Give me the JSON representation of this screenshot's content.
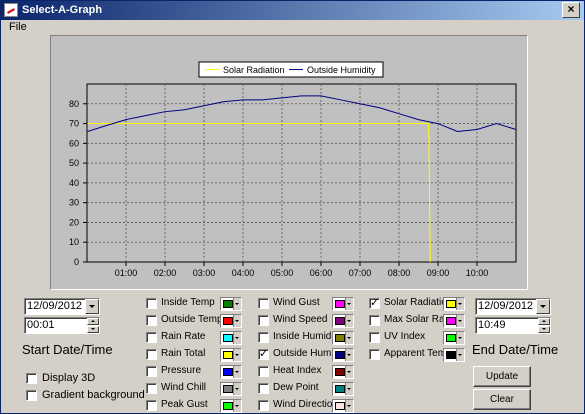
{
  "window": {
    "title": "Select-A-Graph",
    "close_glyph": "×"
  },
  "menu": {
    "file": "File"
  },
  "chart_data": {
    "type": "line",
    "legend": [
      "Solar Radiation",
      "Outside Humidity"
    ],
    "legend_position": "top-center",
    "grid": true,
    "ylim": [
      0,
      90
    ],
    "yticks": [
      "0",
      "10",
      "20",
      "30",
      "40",
      "50",
      "60",
      "70",
      "80"
    ],
    "xlim": [
      "00:00",
      "11:00"
    ],
    "xticks": [
      "01:00",
      "02:00",
      "03:00",
      "04:00",
      "05:00",
      "06:00",
      "07:00",
      "08:00",
      "09:00",
      "10:00"
    ],
    "series": [
      {
        "name": "Solar Radiation",
        "color": "#ffff00",
        "x": [
          "00:01",
          "08:45",
          "08:46",
          "08:48"
        ],
        "y": [
          70,
          70,
          65,
          0
        ]
      },
      {
        "name": "Outside Humidity",
        "color": "#000080",
        "x": [
          "00:01",
          "00:30",
          "01:00",
          "01:30",
          "02:00",
          "02:30",
          "03:00",
          "03:30",
          "04:00",
          "04:30",
          "05:00",
          "05:30",
          "06:00",
          "06:30",
          "07:00",
          "07:30",
          "08:00",
          "08:30",
          "08:45",
          "09:00",
          "09:30",
          "10:00",
          "10:30",
          "11:00"
        ],
        "y": [
          66,
          69,
          72,
          74,
          76,
          77,
          79,
          81,
          82,
          82,
          83,
          84,
          84,
          82,
          80,
          78,
          75,
          72,
          71,
          70,
          66,
          67,
          70,
          67
        ]
      }
    ]
  },
  "start": {
    "date": "12/09/2012",
    "time": "00:01",
    "label": "Start Date/Time"
  },
  "end": {
    "date": "12/09/2012",
    "time": "10:49",
    "label": "End Date/Time"
  },
  "options": {
    "display3d": "Display 3D",
    "gradient": "Gradient background"
  },
  "series_col1": [
    {
      "label": "Inside Temp",
      "checked": false,
      "color": "#008000"
    },
    {
      "label": "Outside Temp",
      "checked": false,
      "color": "#ff0000"
    },
    {
      "label": "Rain Rate",
      "checked": false,
      "color": "#00ffff"
    },
    {
      "label": "Rain Total",
      "checked": false,
      "color": "#ffff00"
    },
    {
      "label": "Pressure",
      "checked": false,
      "color": "#0000ff"
    },
    {
      "label": "Wind Chill",
      "checked": false,
      "color": "#808080"
    },
    {
      "label": "Peak Gust",
      "checked": false,
      "color": "#00ff00"
    }
  ],
  "series_col2": [
    {
      "label": "Wind Gust",
      "checked": false,
      "color": "#ff00ff"
    },
    {
      "label": "Wind Speed",
      "checked": false,
      "color": "#800080"
    },
    {
      "label": "Inside Humidity",
      "checked": false,
      "color": "#808000"
    },
    {
      "label": "Outside Humidit",
      "checked": true,
      "color": "#000080"
    },
    {
      "label": "Heat Index",
      "checked": false,
      "color": "#800000"
    },
    {
      "label": "Dew Point",
      "checked": false,
      "color": "#008080"
    },
    {
      "label": "Wind Direction",
      "checked": false,
      "color": "#ffe0e0"
    }
  ],
  "series_col3": [
    {
      "label": "Solar Radiation",
      "checked": true,
      "color": "#ffff00"
    },
    {
      "label": "Max Solar Rad",
      "checked": false,
      "color": "#ff00ff"
    },
    {
      "label": "UV Index",
      "checked": false,
      "color": "#00ff00"
    },
    {
      "label": "Apparent Temp",
      "checked": false,
      "color": "#000000"
    }
  ],
  "buttons": {
    "update": "Update",
    "clear": "Clear"
  }
}
